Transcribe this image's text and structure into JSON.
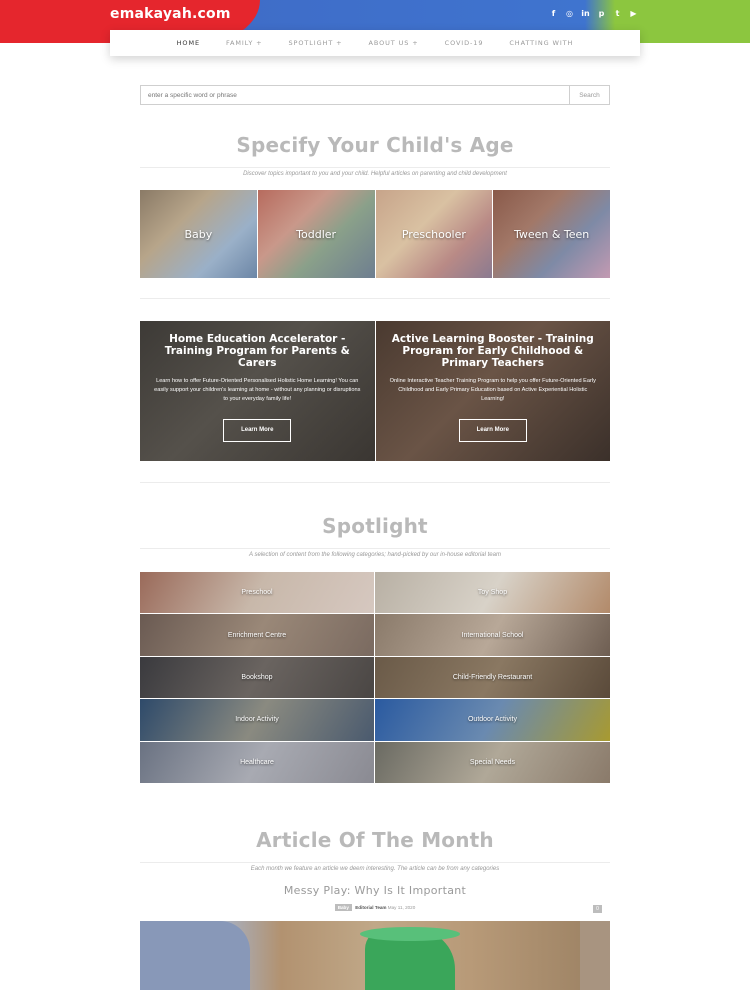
{
  "header": {
    "logo": "emakayah.com",
    "socials": [
      {
        "icon": "facebook-icon",
        "glyph": "f"
      },
      {
        "icon": "instagram-icon",
        "glyph": "◎"
      },
      {
        "icon": "linkedin-icon",
        "glyph": "in"
      },
      {
        "icon": "pinterest-icon",
        "glyph": "p"
      },
      {
        "icon": "twitter-icon",
        "glyph": "t"
      },
      {
        "icon": "youtube-icon",
        "glyph": "▶"
      }
    ],
    "nav": [
      "HOME",
      "FAMILY +",
      "SPOTLIGHT +",
      "ABOUT US +",
      "COVID-19",
      "CHATTING WITH"
    ]
  },
  "search": {
    "placeholder": "enter a specific word or phrase",
    "button": "Search"
  },
  "age_section": {
    "title": "Specify Your Child's Age",
    "subtitle": "Discover topics important to you and your child. Helpful articles on parenting and child development",
    "tiles": [
      "Baby",
      "Toddler",
      "Preschooler",
      "Tween & Teen"
    ]
  },
  "promos": [
    {
      "title": "Home Education Accelerator - Training Program for Parents & Carers",
      "text": "Learn how to offer Future-Oriented Personalised Holistic Home Learning! You can easily support your children's learning at home - without any planning or disruptions to your everyday family life!",
      "button": "Learn More"
    },
    {
      "title": "Active Learning Booster - Training Program for Early Childhood & Primary Teachers",
      "text": "Online Interactive Teacher Training Program to help you offer Future-Oriented Early Childhood and Early Primary Education based on Active Experiential Holistic Learning!",
      "button": "Learn More"
    }
  ],
  "spotlight": {
    "title": "Spotlight",
    "subtitle": "A selection of content from the following categories; hand-picked by our in-house editorial team",
    "items": [
      "Preschool",
      "Toy Shop",
      "Enrichment Centre",
      "International School",
      "Bookshop",
      "Child-Friendly Restaurant",
      "Indoor Activity",
      "Outdoor Activity",
      "Healthcare",
      "Special Needs"
    ]
  },
  "article_month": {
    "title": "Article Of The Month",
    "subtitle": "Each month we feature an article we deem interesting. The article can be from any categories",
    "article_title": "Messy Play: Why Is It Important",
    "tag": "Baby",
    "author": "Editorial Team",
    "date": "May 11, 2020",
    "comments": "0"
  }
}
